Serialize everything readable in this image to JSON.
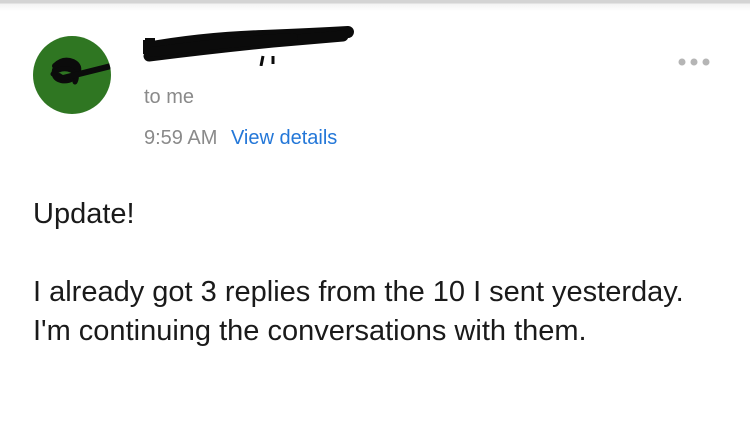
{
  "email": {
    "sender": {
      "name": "",
      "name_redacted": true,
      "avatar_color": "#2f7622",
      "avatar_icon": "redaction-scribble-icon"
    },
    "recipient_label": "to me",
    "time": "9:59 AM",
    "details_link": "View details",
    "more_icon": "more-horizontal-icon",
    "body": {
      "greeting": "Update!",
      "paragraph": "I already got 3 replies from the 10 I sent yesterday. I'm continuing the conversations with them."
    }
  },
  "colors": {
    "link": "#2377d8",
    "secondary_text": "#8a8a8a",
    "body_text": "#1a1a1a"
  }
}
